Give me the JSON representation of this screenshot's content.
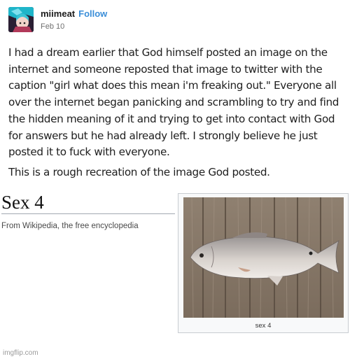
{
  "post": {
    "username": "miimeat",
    "follow_label": "Follow",
    "date": "Feb 10",
    "paragraph1": "I had a dream earlier that God himself posted an image on the internet and someone reposted that image to twitter with the caption \"girl what does this mean i'm freaking out.\" Everyone all over the internet began panicking and scrambling to try and find the hidden meaning of it and trying to get into contact with God for answers but he had already left. I strongly believe he just posted it to fuck with everyone.",
    "paragraph2": "This is a rough recreation of the image God posted."
  },
  "wiki": {
    "title": "Sex 4",
    "subtitle": "From Wikipedia, the free encyclopedia",
    "image_caption": "sex 4"
  },
  "watermark": "imgflip.com",
  "colors": {
    "follow": "#3b8ed8",
    "wood": "#8a7a68"
  }
}
